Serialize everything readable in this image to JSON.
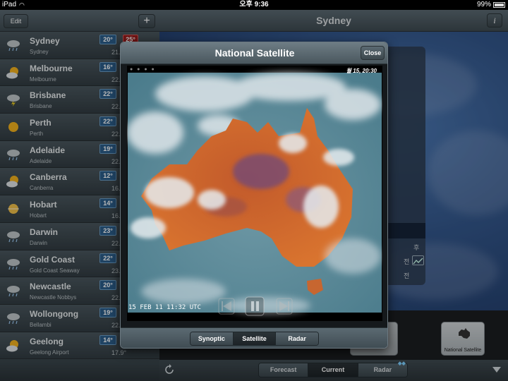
{
  "status_bar": {
    "carrier": "iPad",
    "time": "오후 9:36",
    "battery": "99%"
  },
  "left_panel": {
    "edit_label": "Edit",
    "add_label": "+",
    "cities": [
      {
        "name": "Sydney",
        "station": "Sydney",
        "temp": "20°",
        "max": "25°",
        "current": "21.",
        "icon": "cloud-rain-icon"
      },
      {
        "name": "Melbourne",
        "station": "Melbourne",
        "temp": "16°",
        "current": "22.",
        "icon": "partly-cloudy-icon"
      },
      {
        "name": "Brisbane",
        "station": "Brisbane",
        "temp": "22°",
        "current": "22.",
        "icon": "storm-cloud-icon"
      },
      {
        "name": "Perth",
        "station": "Perth",
        "temp": "22°",
        "current": "22.",
        "icon": "sun-icon"
      },
      {
        "name": "Adelaide",
        "station": "Adelaide",
        "temp": "19°",
        "current": "22.",
        "icon": "cloud-rain-icon"
      },
      {
        "name": "Canberra",
        "station": "Canberra",
        "temp": "12°",
        "current": "16.",
        "icon": "partly-cloudy-icon"
      },
      {
        "name": "Hobart",
        "station": "Hobart",
        "temp": "14°",
        "current": "16.",
        "icon": "hazy-sun-icon"
      },
      {
        "name": "Darwin",
        "station": "Darwin",
        "temp": "23°",
        "current": "22.",
        "icon": "cloud-rain-icon"
      },
      {
        "name": "Gold Coast",
        "station": "Gold Coast Seaway",
        "temp": "22°",
        "current": "23.",
        "icon": "cloud-rain-icon"
      },
      {
        "name": "Newcastle",
        "station": "Newcastle Nobbys",
        "temp": "20°",
        "current": "22.",
        "icon": "cloud-rain-icon"
      },
      {
        "name": "Wollongong",
        "station": "Bellambi",
        "temp": "19°",
        "current": "22.",
        "icon": "cloud-rain-icon"
      },
      {
        "name": "Geelong",
        "station": "Geelong Airport",
        "temp": "14°",
        "current": "17.9°",
        "icon": "partly-cloudy-icon"
      }
    ]
  },
  "right_panel": {
    "title": "Sydney",
    "info_label": "i",
    "card_labels": [
      "후",
      "전",
      "전"
    ],
    "tile_label": "National Satellite",
    "bottom_tabs": [
      {
        "label": "Forecast",
        "active": false
      },
      {
        "label": "Current",
        "active": true
      },
      {
        "label": "Radar",
        "active": false
      }
    ]
  },
  "modal": {
    "title": "National Satellite",
    "close_label": "Close",
    "frame_date": "월 15, 20:30",
    "timestamp": "15 FEB 11 11:32 UTC",
    "tabs": [
      {
        "label": "Synoptic",
        "active": false
      },
      {
        "label": "Satellite",
        "active": true
      },
      {
        "label": "Radar",
        "active": false
      }
    ]
  }
}
